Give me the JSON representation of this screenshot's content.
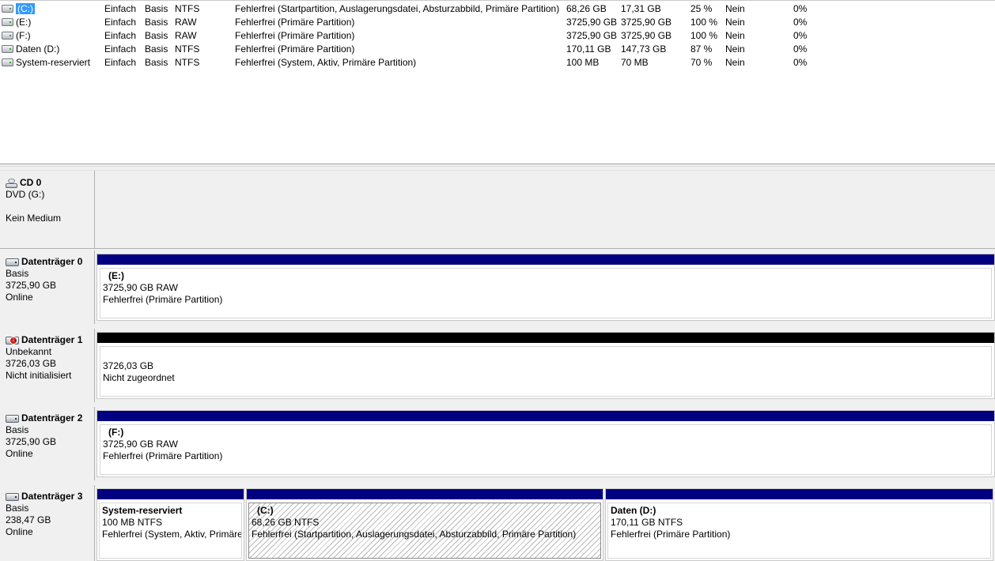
{
  "volumes": [
    {
      "name": "(C:)",
      "layout": "Einfach",
      "type": "Basis",
      "fs": "NTFS",
      "status": "Fehlerfrei (Startpartition, Auslagerungsdatei, Absturzabbild, Primäre Partition)",
      "capacity": "68,26 GB",
      "free": "17,31 GB",
      "pct_free": "25 %",
      "fault_tolerance": "Nein",
      "overhead": "0%",
      "selected": true
    },
    {
      "name": "(E:)",
      "layout": "Einfach",
      "type": "Basis",
      "fs": "RAW",
      "status": "Fehlerfrei (Primäre Partition)",
      "capacity": "3725,90 GB",
      "free": "3725,90 GB",
      "pct_free": "100 %",
      "fault_tolerance": "Nein",
      "overhead": "0%"
    },
    {
      "name": "(F:)",
      "layout": "Einfach",
      "type": "Basis",
      "fs": "RAW",
      "status": "Fehlerfrei (Primäre Partition)",
      "capacity": "3725,90 GB",
      "free": "3725,90 GB",
      "pct_free": "100 %",
      "fault_tolerance": "Nein",
      "overhead": "0%"
    },
    {
      "name": "Daten (D:)",
      "layout": "Einfach",
      "type": "Basis",
      "fs": "NTFS",
      "status": "Fehlerfrei (Primäre Partition)",
      "capacity": "170,11 GB",
      "free": "147,73 GB",
      "pct_free": "87 %",
      "fault_tolerance": "Nein",
      "overhead": "0%"
    },
    {
      "name": "System-reserviert",
      "layout": "Einfach",
      "type": "Basis",
      "fs": "NTFS",
      "status": "Fehlerfrei (System, Aktiv, Primäre Partition)",
      "capacity": "100 MB",
      "free": "70 MB",
      "pct_free": "70 %",
      "fault_tolerance": "Nein",
      "overhead": "0%"
    }
  ],
  "disks": {
    "cd0": {
      "title": "CD 0",
      "line1": "DVD (G:)",
      "line2": "",
      "line3": "Kein Medium"
    },
    "disk0": {
      "title": "Datenträger 0",
      "line1": "Basis",
      "line2": "3725,90 GB",
      "line3": "Online",
      "partitions": [
        {
          "name": "(E:)",
          "size": "3725,90 GB RAW",
          "status": "Fehlerfrei (Primäre Partition)"
        }
      ]
    },
    "disk1": {
      "title": "Datenträger 1",
      "line1": "Unbekannt",
      "line2": "3726,03 GB",
      "line3": "Nicht initialisiert",
      "partitions": [
        {
          "name": "",
          "size": "3726,03 GB",
          "status": "Nicht zugeordnet"
        }
      ]
    },
    "disk2": {
      "title": "Datenträger 2",
      "line1": "Basis",
      "line2": "3725,90 GB",
      "line3": "Online",
      "partitions": [
        {
          "name": "(F:)",
          "size": "3725,90 GB RAW",
          "status": "Fehlerfrei (Primäre Partition)"
        }
      ]
    },
    "disk3": {
      "title": "Datenträger 3",
      "line1": "Basis",
      "line2": "238,47 GB",
      "line3": "Online",
      "partitions": [
        {
          "name": "System-reserviert",
          "size": "100 MB NTFS",
          "status": "Fehlerfrei (System, Aktiv, Primäre"
        },
        {
          "name": "(C:)",
          "size": "68,26 GB NTFS",
          "status": "Fehlerfrei (Startpartition, Auslagerungsdatei, Absturzabbild, Primäre Partition)"
        },
        {
          "name": "Daten  (D:)",
          "size": "170,11 GB NTFS",
          "status": "Fehlerfrei (Primäre Partition)"
        }
      ]
    }
  },
  "colors": {
    "primary_partition_bar": "#000080",
    "unallocated_bar": "#000000",
    "selection": "#3399ff"
  }
}
